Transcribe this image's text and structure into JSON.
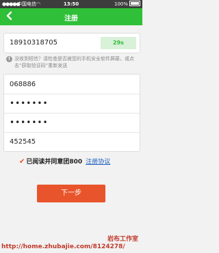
{
  "status_bar": {
    "signal": "●●●●●",
    "carrier": "中国电信",
    "wifi_icon": "wifi-icon",
    "time": "13:50",
    "battery": "100%"
  },
  "header": {
    "title": "注册",
    "back_icon": "back-arrow-icon"
  },
  "colors": {
    "accent": "#2fbf38",
    "button": "#e8542b",
    "link": "#1f5fbf"
  },
  "phone": {
    "number": "18910318705",
    "countdown": "29s"
  },
  "notice": {
    "icon": "info-icon",
    "text": "没收到短信？请检查是否被您的手机安全软件屏蔽，或点击“获取验证码”重新发送"
  },
  "form": {
    "verification_code": "068886",
    "password": "•••••••",
    "confirm_password": "•••••••",
    "invite_code": "452545"
  },
  "agreement": {
    "checked": true,
    "text": "已阅读并同意团800",
    "link": "注册协议"
  },
  "next_button": "下一步",
  "watermark": {
    "line1": "岩布工作室",
    "line2": "http://home.zhubajie.com/8124278/"
  }
}
